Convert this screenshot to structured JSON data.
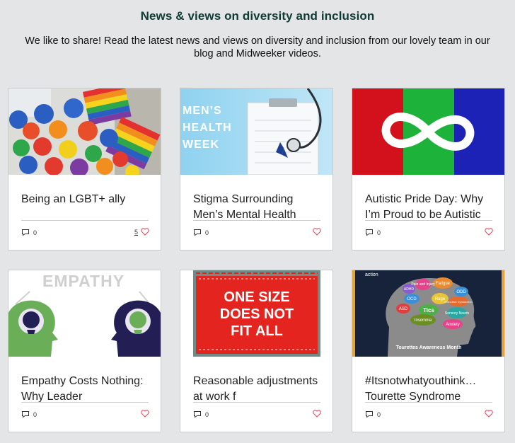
{
  "header": {
    "title": "News & views on diversity and inclusion",
    "intro": "We like to share! Read the latest news and views on diversity and inclusion from our lovely team in our blog and Midweeker videos."
  },
  "colors": {
    "title": "#0e3b33",
    "heart": "#e0405a",
    "background": "#e3e5e6"
  },
  "posts": [
    {
      "title": "Being an LGBT+ ally",
      "comments": "0",
      "likes": "5",
      "image": "rainbow-balloons-and-pride-flags"
    },
    {
      "title": "Stigma Surrounding Men’s Mental Health",
      "comments": "0",
      "likes": "",
      "image": "mens-health-week-stethoscope"
    },
    {
      "title": "Autistic Pride Day: Why I’m Proud to be Autistic",
      "comments": "0",
      "likes": "",
      "image": "infinity-symbol-on-colored-bands"
    },
    {
      "title": "Empathy Costs Nothing: Why Leader",
      "comments": "0",
      "likes": "",
      "image": "empathy-two-heads"
    },
    {
      "title": "Reasonable adjustments at work f",
      "comments": "0",
      "likes": "",
      "image": "one-size-does-not-fit-all-label"
    },
    {
      "title": "#Itsnotwhatyouthink… Tourette Syndrome",
      "comments": "0",
      "likes": "",
      "image": "tourettes-awareness-brain"
    }
  ],
  "images": {
    "mens_health": [
      "MEN’S",
      "HEALTH",
      "WEEK"
    ],
    "empathy": "EMPATHY",
    "one_size": [
      "ONE SIZE",
      "DOES NOT",
      "FIT ALL"
    ],
    "tourettes_top": "action",
    "tourettes_caption": "Tourettes Awareness Month",
    "tourettes_words": [
      "Pain and Injury",
      "Fatigue",
      "Anxiety",
      "OCD",
      "Rage",
      "Tics",
      "ASD",
      "Insomnia",
      "Sensory Needs",
      "ODD",
      "ADHD",
      "Executive Dysfunction"
    ]
  }
}
